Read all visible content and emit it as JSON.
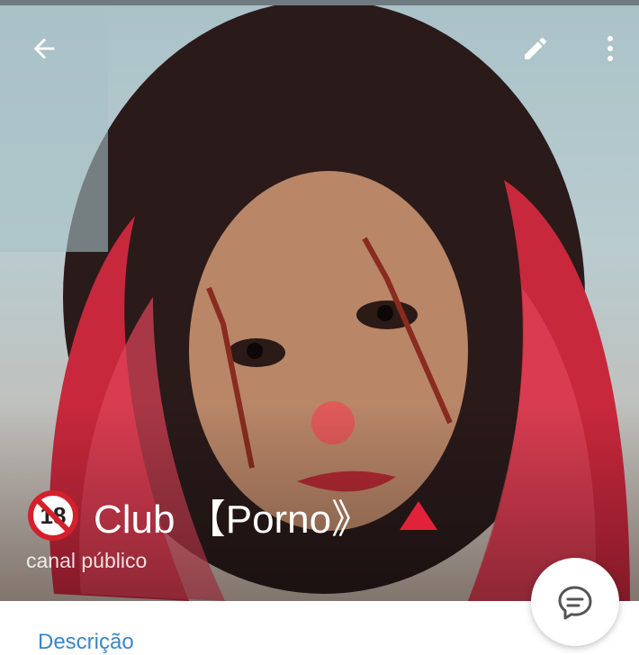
{
  "header": {
    "icons": {
      "back": "arrow-left-icon",
      "edit": "pencil-icon",
      "more": "more-vertical-icon"
    }
  },
  "channel": {
    "adult_badge_icon": "no-under-18-icon",
    "title": "Club 【Porno》",
    "title_suffix_icon": "red-triangle-icon",
    "subtitle": "canal público"
  },
  "fab": {
    "icon": "message-icon"
  },
  "section": {
    "label": "Descrição"
  },
  "colors": {
    "accent": "#3a86c7",
    "triangle": "#e2223a",
    "badge": "#d4202c"
  }
}
